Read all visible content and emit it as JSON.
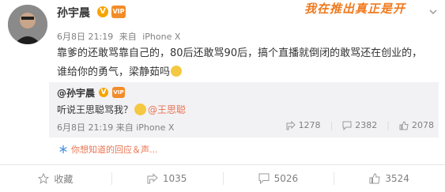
{
  "post": {
    "username": "孙宇晨",
    "verified_icon": "v-badge-icon",
    "vip_icon": "vip-badge-icon",
    "banner_text": "我在推出真正是开",
    "timestamp": "6月8日 21:19",
    "source_prefix": "来自",
    "source": "iPhone X",
    "text_line1": "靠爹的还敢骂靠自己的，80后还敢骂90后，搞个直播就倒闭的敢骂还在创业的，",
    "text_line2": "谁给你的勇气，梁静茹吗",
    "text_emoji_icon": "doge-emoji-icon"
  },
  "repost": {
    "username": "@孙宇晨",
    "text_prefix": "听说王思聪骂我？",
    "smile_icon": "smile-emoji-icon",
    "mention": "@王思聪",
    "timestamp": "6月8日 21:19",
    "source_prefix": "来自",
    "source": "iPhone X",
    "stats": {
      "shares": "1278",
      "comments": "2382",
      "likes": "2078"
    }
  },
  "related": {
    "icon": "snowflake-icon",
    "label": "你想知道的回应＆声..."
  },
  "actions": {
    "favorite": "收藏",
    "shares": "1035",
    "comments": "5026",
    "likes": "3524"
  },
  "colors": {
    "accent": "#eb7350",
    "gold": "#f7a400",
    "text": "#333333",
    "muted": "#808080"
  }
}
